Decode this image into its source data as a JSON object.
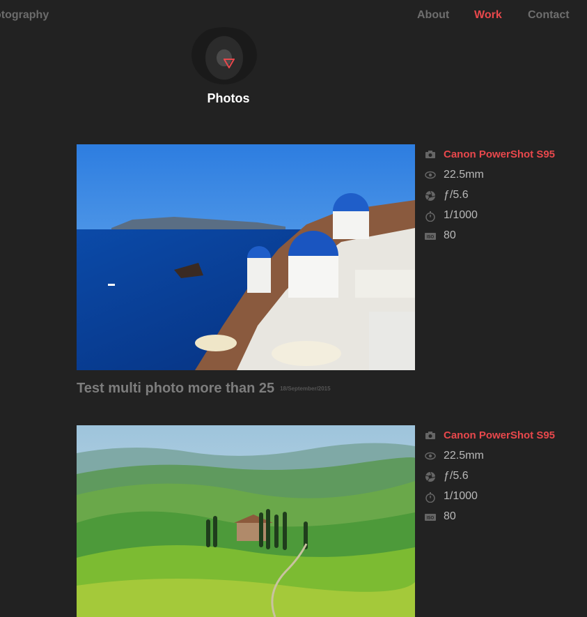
{
  "header": {
    "brand": "otography",
    "nav": [
      {
        "label": "About",
        "active": false
      },
      {
        "label": "Work",
        "active": true
      },
      {
        "label": "Contact",
        "active": false
      }
    ]
  },
  "logo": {
    "label": "Photos"
  },
  "colors": {
    "accent": "#e8484c",
    "background": "#222222"
  },
  "posts": [
    {
      "title": "Test multi photo more than 25",
      "date": "18/September/2015",
      "photo_subject": "Santorini coastline with blue domes",
      "exif": {
        "camera": "Canon PowerShot S95",
        "focal_length": "22.5mm",
        "aperture": "ƒ/5.6",
        "shutter": "1/1000",
        "iso": "80"
      }
    },
    {
      "photo_subject": "Rolling green Tuscan hills",
      "exif": {
        "camera": "Canon PowerShot S95",
        "focal_length": "22.5mm",
        "aperture": "ƒ/5.6",
        "shutter": "1/1000",
        "iso": "80"
      }
    }
  ],
  "icons": [
    "camera-icon",
    "eye-icon",
    "aperture-icon",
    "stopwatch-icon",
    "iso-icon"
  ]
}
